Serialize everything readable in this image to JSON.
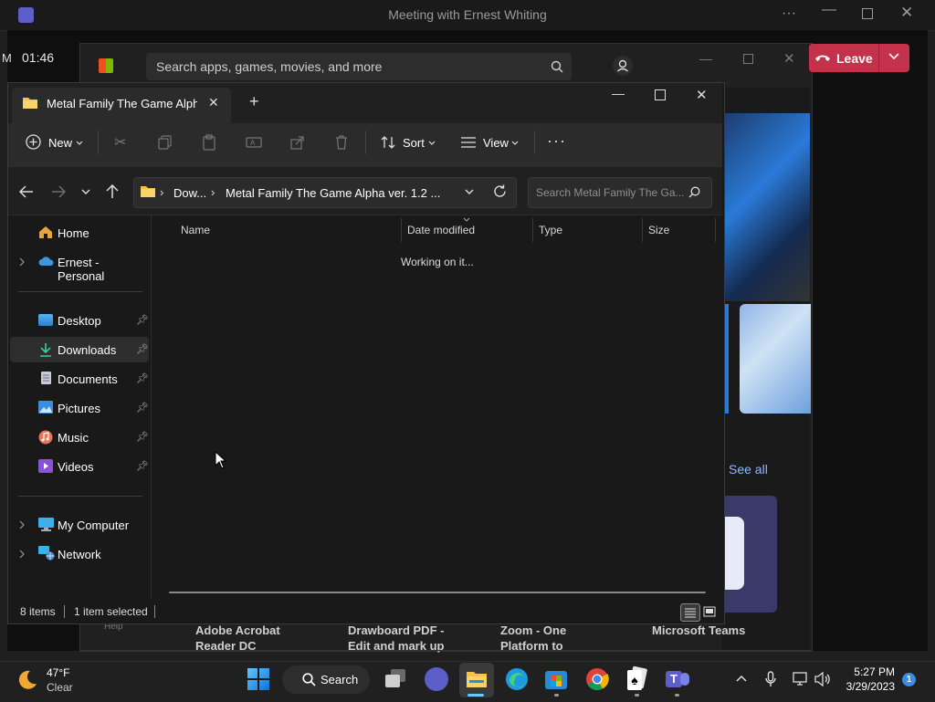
{
  "teams": {
    "window_title": "Meeting with Ernest Whiting",
    "timer": "01:46",
    "leave_label": "Leave"
  },
  "store": {
    "search_placeholder": "Search apps, games, movies, and more",
    "see_all": "See all",
    "help_label": "Help",
    "apps": [
      {
        "line1": "Adobe Acrobat",
        "line2": "Reader DC"
      },
      {
        "line1": "Drawboard PDF -",
        "line2": "Edit and mark up"
      },
      {
        "line1": "Zoom - One",
        "line2": "Platform to"
      },
      {
        "line1": "Microsoft Teams",
        "line2": ""
      }
    ]
  },
  "explorer": {
    "tab_title": "Metal Family The Game Alpha",
    "toolbar": {
      "new_label": "New",
      "sort_label": "Sort",
      "view_label": "View"
    },
    "address": {
      "crumb1": "Dow...",
      "crumb2": "Metal Family The Game Alpha ver. 1.2 ..."
    },
    "search_placeholder": "Search Metal Family The Ga...",
    "nav": {
      "home": "Home",
      "onedrive": "Ernest - Personal",
      "desktop": "Desktop",
      "downloads": "Downloads",
      "documents": "Documents",
      "pictures": "Pictures",
      "music": "Music",
      "videos": "Videos",
      "mycomputer": "My Computer",
      "network": "Network"
    },
    "columns": {
      "name": "Name",
      "date": "Date modified",
      "type": "Type",
      "size": "Size"
    },
    "working_text": "Working on it...",
    "status": {
      "items": "8 items",
      "selected": "1 item selected"
    }
  },
  "taskbar": {
    "weather_temp": "47°F",
    "weather_desc": "Clear",
    "search_label": "Search",
    "time": "5:27 PM",
    "date": "3/29/2023",
    "notification_count": "1"
  },
  "colors": {
    "accent": "#0078d4",
    "leave_red": "#c4314b",
    "folder_yellow": "#f5c446"
  }
}
